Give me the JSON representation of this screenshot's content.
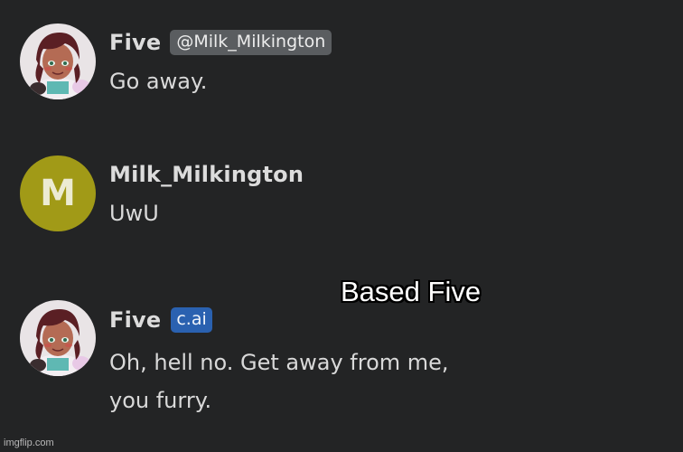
{
  "messages": [
    {
      "author": "Five",
      "tag": "@Milk_Milkington",
      "lines": [
        "Go away."
      ],
      "avatar_icon": "anime-character-avatar"
    },
    {
      "author": "Milk_Milkington",
      "avatar_letter": "M",
      "avatar_color": "#a19a17",
      "lines": [
        "UwU"
      ]
    },
    {
      "author": "Five",
      "tag": "c.ai",
      "tag_color": "#2a61b0",
      "lines": [
        "Oh, hell no. Get away from me,",
        "you furry."
      ],
      "avatar_icon": "anime-character-avatar"
    }
  ],
  "caption": "Based Five",
  "watermark": "imgflip.com",
  "colors": {
    "background": "#232425",
    "text": "#d9d9d9"
  }
}
